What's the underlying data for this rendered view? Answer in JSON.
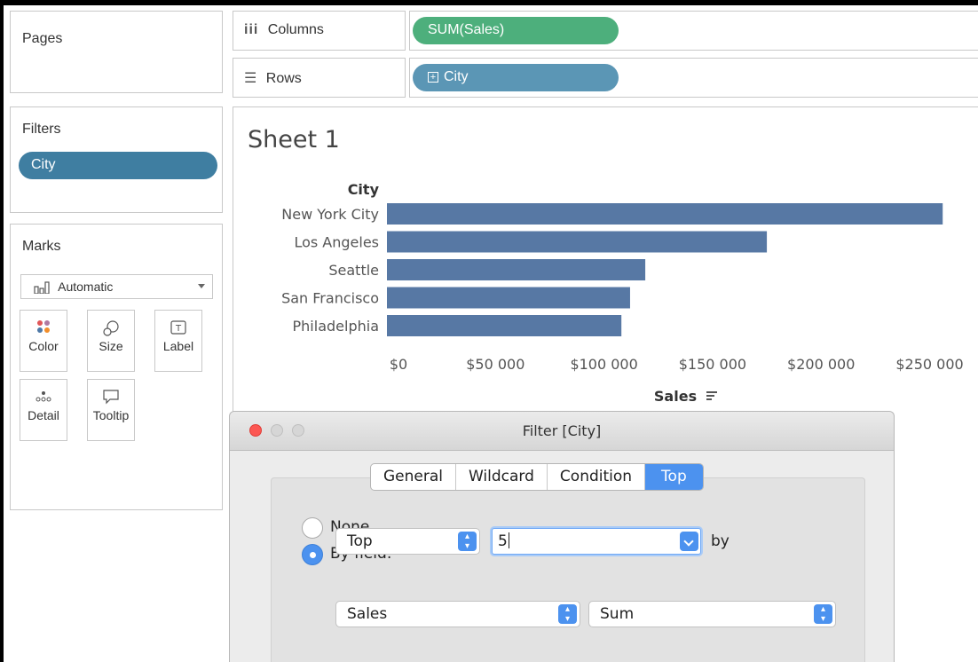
{
  "sidebar": {
    "pages_title": "Pages",
    "filters_title": "Filters",
    "filter_pill": "City",
    "marks_title": "Marks",
    "mark_type": "Automatic",
    "mark_buttons": [
      {
        "label": "Color",
        "icon": "color-dots-icon"
      },
      {
        "label": "Size",
        "icon": "size-icon"
      },
      {
        "label": "Label",
        "icon": "label-icon"
      },
      {
        "label": "Detail",
        "icon": "detail-icon"
      },
      {
        "label": "Tooltip",
        "icon": "tooltip-icon"
      }
    ]
  },
  "shelves": {
    "columns_label": "Columns",
    "columns_pill": "SUM(Sales)",
    "rows_label": "Rows",
    "rows_pill": "City"
  },
  "sheet": {
    "title": "Sheet 1"
  },
  "chart_data": {
    "type": "bar",
    "orientation": "horizontal",
    "row_header": "City",
    "categories": [
      "New York City",
      "Los Angeles",
      "Seattle",
      "San Francisco",
      "Philadelphia"
    ],
    "values": [
      256000,
      175000,
      119000,
      112000,
      108000
    ],
    "x_ticks": [
      "$0",
      "$50 000",
      "$100 000",
      "$150 000",
      "$200 000",
      "$250 000"
    ],
    "x_tick_values": [
      0,
      50000,
      100000,
      150000,
      200000,
      250000
    ],
    "xlabel": "Sales",
    "xlim": [
      0,
      260000
    ],
    "bar_color": "#5778a4",
    "grid": false
  },
  "dialog": {
    "title": "Filter [City]",
    "tabs": [
      "General",
      "Wildcard",
      "Condition",
      "Top"
    ],
    "active_tab": "Top",
    "radio_none": "None",
    "radio_by_field": "By field:",
    "top_select": "Top",
    "count_value": "5",
    "by_label": "by",
    "field_select": "Sales",
    "aggregation_select": "Sum"
  },
  "colors": {
    "accent": "#4c92ef",
    "filter_pill": "#3f7ea1",
    "columns_pill": "#4daf7c",
    "rows_pill": "#5b96b5",
    "close_button": "#fc5753"
  }
}
